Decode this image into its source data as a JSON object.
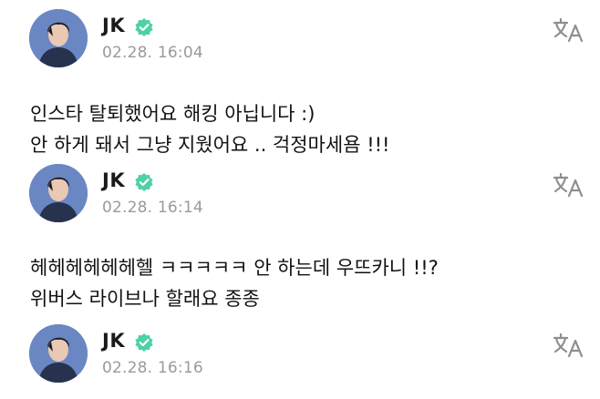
{
  "posts": [
    {
      "author": "JK",
      "timestamp": "02.28. 16:04",
      "lines": [
        "인스타 탈퇴했어요 해킹 아닙니다 :)",
        "안 하게 돼서 그냥 지웠어요 .. 걱정마세욤 !!!"
      ]
    },
    {
      "author": "JK",
      "timestamp": "02.28. 16:14",
      "lines": [
        "헤헤헤헤헤헤헬 ㅋㅋㅋㅋㅋ 안 하는데 우뜨카니 !!?",
        "위버스 라이브나 할래요 종종"
      ]
    },
    {
      "author": "JK",
      "timestamp": "02.28. 16:16",
      "lines": []
    }
  ],
  "icons": {
    "verified": "verified-badge-icon",
    "translate": "translate-icon"
  },
  "colors": {
    "verified_badge": "#4ed0a8",
    "timestamp": "#9a9a9a",
    "translate_icon": "#8e8e8e",
    "avatar_bg": "#5c79b5"
  }
}
